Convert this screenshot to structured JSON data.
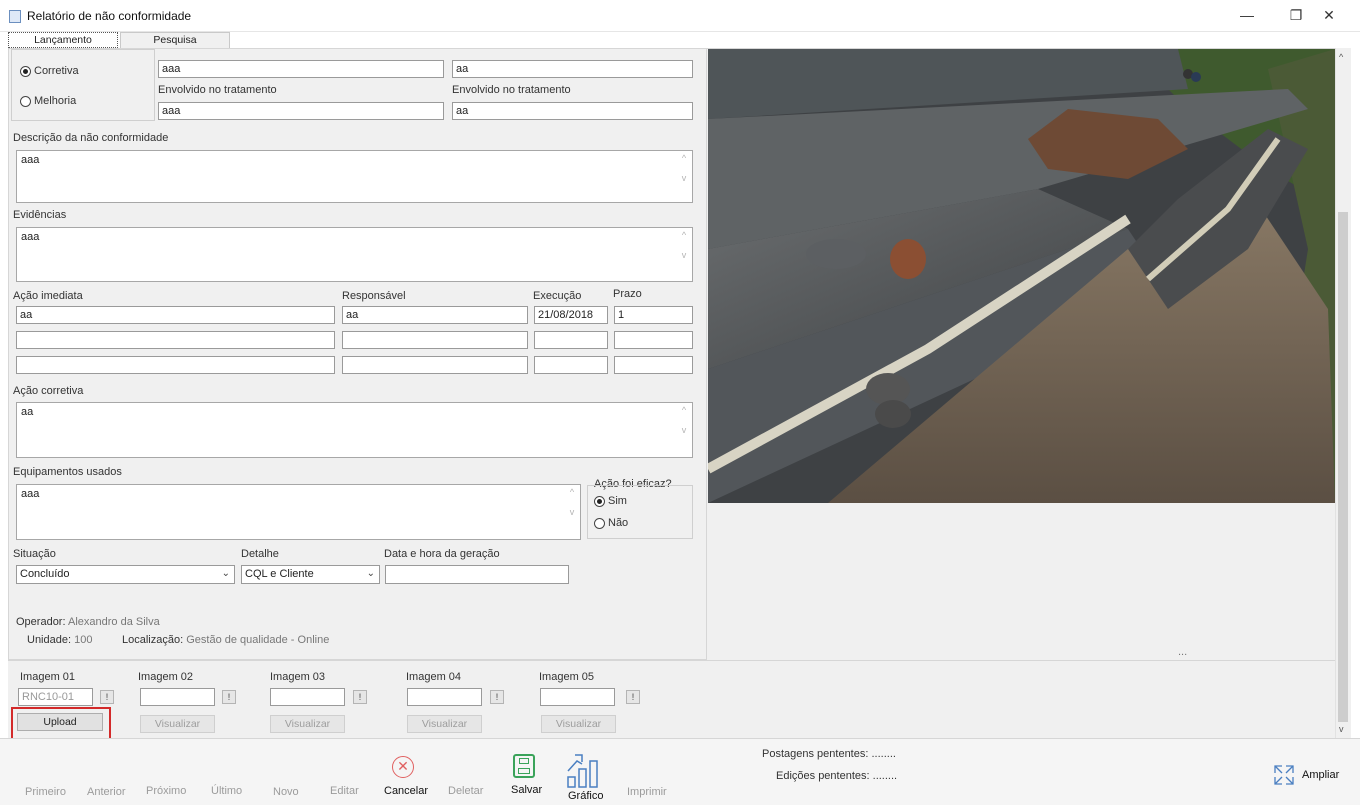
{
  "window": {
    "title": "Relatório de não conformidade",
    "minimize": "—",
    "restore": "❐",
    "close": "✕"
  },
  "tabs": [
    {
      "label": "Lançamento"
    },
    {
      "label": "Pesquisa"
    }
  ],
  "type_group": {
    "option1": "Corretiva",
    "option2": "Melhoria"
  },
  "top_fields": {
    "row1_left": "aaa",
    "row1_right": "aa",
    "label_involved_left": "Envolvido no tratamento",
    "label_involved_right": "Envolvido no tratamento",
    "row2_left": "aaa",
    "row2_right": "aa"
  },
  "description": {
    "label": "Descrição da não conformidade",
    "value": "aaa"
  },
  "evidence": {
    "label": "Evidências",
    "value": "aaa"
  },
  "immediate_action": {
    "label": "Ação imediata",
    "responsible_label": "Responsável",
    "execution_label": "Execução",
    "deadline_label": "Prazo",
    "rows": [
      {
        "action": "aa",
        "responsible": "aa",
        "execution": "21/08/2018",
        "deadline": "1"
      }
    ]
  },
  "corrective": {
    "label": "Ação corretiva",
    "value": "aa"
  },
  "equipment": {
    "label": "Equipamentos usados",
    "value": "aaa"
  },
  "effective": {
    "label": "Ação foi eficaz?",
    "yes": "Sim",
    "no": "Não"
  },
  "status": {
    "situation_label": "Situação",
    "situation_value": "Concluído",
    "detail_label": "Detalhe",
    "detail_value": "CQL e Cliente",
    "datetime_label": "Data e hora da geração",
    "datetime_value": ""
  },
  "operator": {
    "operator_label": "Operador:",
    "operator_value": "Alexandro da Silva",
    "unit_label": "Unidade:",
    "unit_value": "100",
    "location_label": "Localização:",
    "location_value": "Gestão de qualidade - Online"
  },
  "images": [
    {
      "label": "Imagem 01",
      "value": "RNC10-01",
      "button": "Upload"
    },
    {
      "label": "Imagem 02",
      "value": "",
      "button": "Visualizar"
    },
    {
      "label": "Imagem 03",
      "value": "",
      "button": "Visualizar"
    },
    {
      "label": "Imagem 04",
      "value": "",
      "button": "Visualizar"
    },
    {
      "label": "Imagem 05",
      "value": "",
      "button": "Visualizar"
    }
  ],
  "image_info_button": "!",
  "ellipsis": "...",
  "toolbar": {
    "first": "Primeiro",
    "previous": "Anterior",
    "next": "Próximo",
    "last": "Último",
    "new": "Novo",
    "edit": "Editar",
    "cancel": "Cancelar",
    "delete": "Deletar",
    "save": "Salvar",
    "chart": "Gráfico",
    "print": "Imprimir",
    "expand": "Ampliar"
  },
  "pending": {
    "posts_label": "Postagens pententes:",
    "posts_value": "........",
    "edits_label": "Edições pententes:",
    "edits_value": "........"
  }
}
